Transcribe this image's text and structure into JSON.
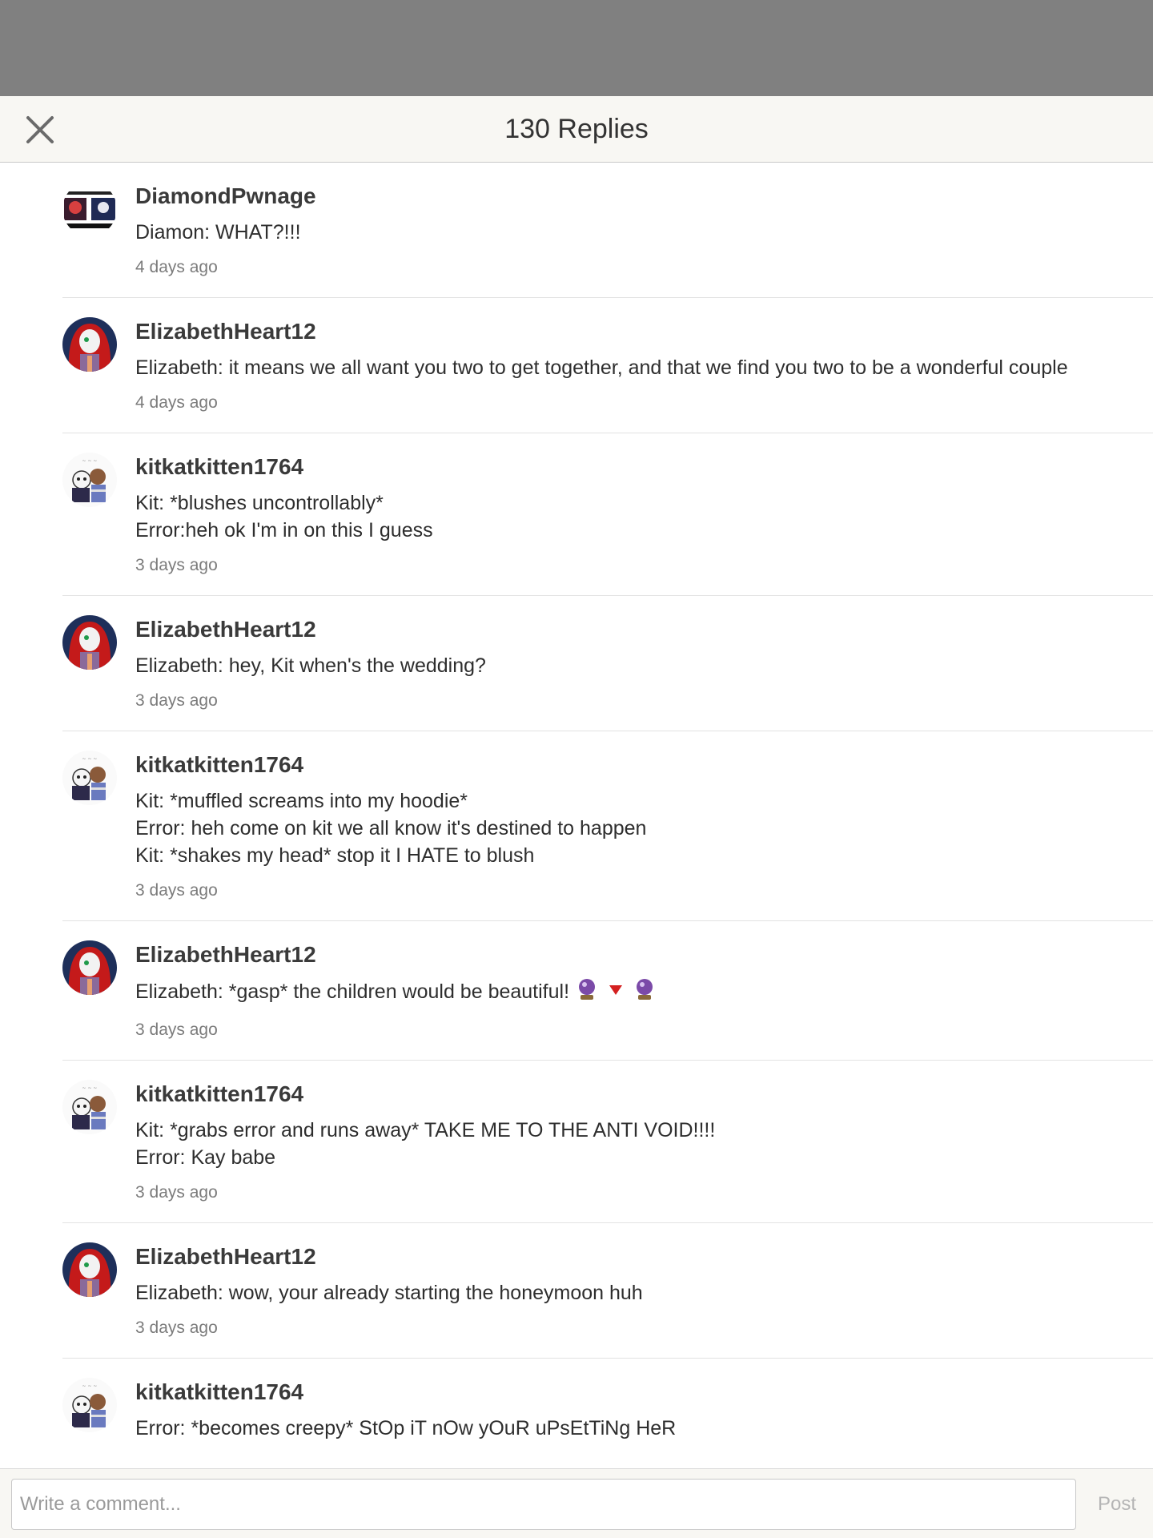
{
  "header": {
    "title": "130 Replies",
    "close_icon": "close-icon"
  },
  "colors": {
    "overlay": "#808080",
    "header_bg": "#f8f7f3",
    "divider": "#e2e2e2",
    "timestamp": "#7b7b7b",
    "post_disabled": "#b5b5b5"
  },
  "replies": [
    {
      "username": "DiamondPwnage",
      "avatar": "diamondpwnage-avatar",
      "lines": [
        "Diamon: WHAT?!!!"
      ],
      "time": "4 days ago"
    },
    {
      "username": "ElizabethHeart12",
      "avatar": "elizabethheart12-avatar",
      "lines": [
        "Elizabeth: it means we all want you two to get together, and that we find you two to be a wonderful couple"
      ],
      "time": "4 days ago"
    },
    {
      "username": "kitkatkitten1764",
      "avatar": "kitkatkitten1764-avatar",
      "lines": [
        "Kit: *blushes uncontrollably*",
        "Error:heh ok I'm in on this I guess"
      ],
      "time": "3 days ago"
    },
    {
      "username": "ElizabethHeart12",
      "avatar": "elizabethheart12-avatar",
      "lines": [
        "Elizabeth: hey, Kit when's the wedding?"
      ],
      "time": "3 days ago"
    },
    {
      "username": "kitkatkitten1764",
      "avatar": "kitkatkitten1764-avatar",
      "lines": [
        "Kit: *muffled screams into my hoodie*",
        "Error: heh come on kit we all know it's destined to happen",
        "Kit: *shakes my head* stop it I HATE to blush"
      ],
      "time": "3 days ago"
    },
    {
      "username": "ElizabethHeart12",
      "avatar": "elizabethheart12-avatar",
      "lines": [
        "Elizabeth: *gasp* the children would be beautiful!"
      ],
      "emojis": [
        "crystal-ball-icon",
        "red-triangle-icon",
        "crystal-ball-icon"
      ],
      "time": "3 days ago"
    },
    {
      "username": "kitkatkitten1764",
      "avatar": "kitkatkitten1764-avatar",
      "lines": [
        "Kit: *grabs error and runs away* TAKE ME TO THE ANTI VOID!!!!",
        "Error: Kay babe"
      ],
      "time": "3 days ago"
    },
    {
      "username": "ElizabethHeart12",
      "avatar": "elizabethheart12-avatar",
      "lines": [
        "Elizabeth: wow, your already starting the honeymoon huh"
      ],
      "time": "3 days ago"
    },
    {
      "username": "kitkatkitten1764",
      "avatar": "kitkatkitten1764-avatar",
      "lines": [
        "Error: *becomes creepy* StOp iT nOw yOuR uPsEtTiNg HeR"
      ],
      "time": ""
    }
  ],
  "composer": {
    "placeholder": "Write a comment...",
    "post_label": "Post"
  }
}
